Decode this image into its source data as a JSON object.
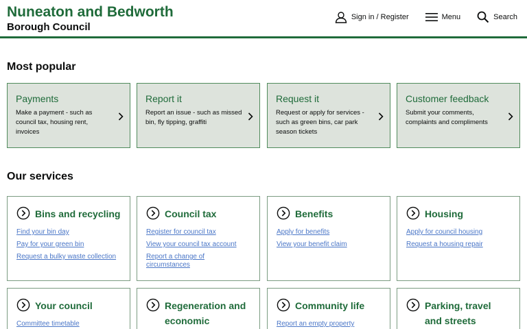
{
  "header": {
    "logo_line1": "Nuneaton and Bedworth",
    "logo_line2": "Borough Council",
    "nav": [
      {
        "label": "Sign in / Register",
        "icon": "user-icon"
      },
      {
        "label": "Menu",
        "icon": "menu-icon"
      },
      {
        "label": "Search",
        "icon": "search-icon"
      }
    ]
  },
  "popular": {
    "title": "Most popular",
    "cards": [
      {
        "title": "Payments",
        "description": "Make a payment - such as council tax, housing rent, invoices"
      },
      {
        "title": "Report it",
        "description": "Report an issue - such as missed bin, fly tipping, graffiti"
      },
      {
        "title": "Request it",
        "description": "Request or apply for services - such as green bins, car park season tickets"
      },
      {
        "title": "Customer feedback",
        "description": "Submit your comments, complaints and compliments"
      }
    ]
  },
  "services": {
    "title": "Our services",
    "cards": [
      {
        "title": "Bins and recycling",
        "links": [
          "Find your bin day",
          "Pay for your green bin",
          "Request a bulky waste collection"
        ]
      },
      {
        "title": "Council tax",
        "links": [
          "Register for council tax",
          "View your council tax account",
          "Report a change of circumstances"
        ]
      },
      {
        "title": "Benefits",
        "links": [
          "Apply for benefits",
          "View your benefit claim"
        ]
      },
      {
        "title": "Housing",
        "links": [
          "Apply for council housing",
          "Request a housing repair"
        ]
      },
      {
        "title": "Your council",
        "links": [
          "Committee timetable"
        ]
      },
      {
        "title": "Regeneration and economic",
        "links": []
      },
      {
        "title": "Community life",
        "links": [
          "Report an empty property"
        ]
      },
      {
        "title": "Parking, travel and streets",
        "links": []
      }
    ]
  },
  "colors": {
    "brand_green": "#1f6b3a",
    "card_bg": "#dde3dc",
    "link_blue": "#4a76c7"
  }
}
